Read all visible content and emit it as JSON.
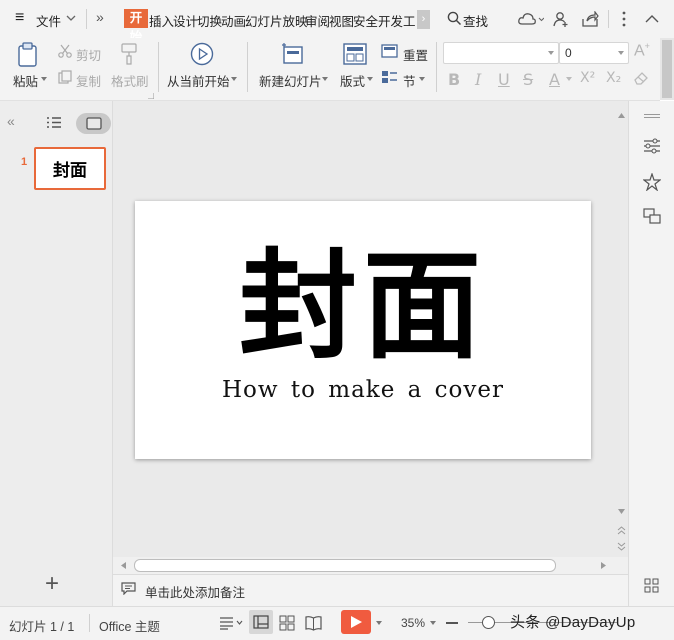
{
  "menu": {
    "hamburger": "≡",
    "file": "文件",
    "more": "»",
    "tabs": [
      "开始",
      "插入",
      "设计",
      "切换",
      "动画",
      "幻灯片放映",
      "审阅",
      "视图",
      "安全",
      "开发工"
    ],
    "search": "查找"
  },
  "ribbon": {
    "paste": "粘贴",
    "cut": "剪切",
    "copy": "复制",
    "format_painter": "格式刷",
    "from_current": "从当前开始",
    "new_slide": "新建幻灯片",
    "layout": "版式",
    "reset": "重置",
    "section": "节",
    "font_size": "0",
    "font_name": "",
    "format_buttons": [
      "B",
      "I",
      "U",
      "S",
      "A",
      "X²",
      "X₂"
    ]
  },
  "slides_panel": {
    "slide_number": "1",
    "thumb_title": "封面",
    "add_label": "+"
  },
  "slide": {
    "title": "封面",
    "subtitle": "How to make a cover"
  },
  "notes": {
    "placeholder": "单击此处添加备注"
  },
  "status": {
    "slide_counter": "幻灯片 1 / 1",
    "theme": "Office 主题",
    "zoom": "35%",
    "watermark": "头条 @DayDayUp"
  },
  "colors": {
    "accent": "#e8693a",
    "play": "#f05b3f"
  }
}
